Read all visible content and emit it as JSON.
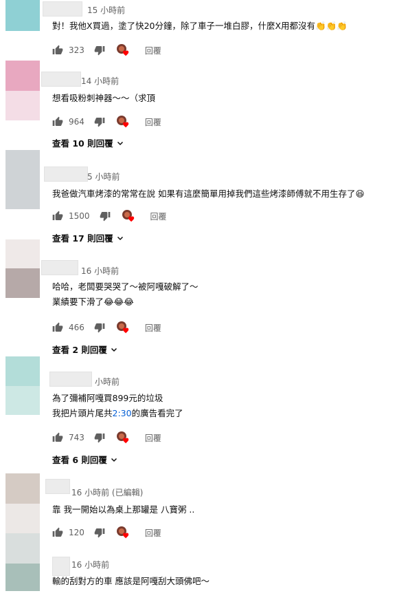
{
  "comments": [
    {
      "time": "15 小時前",
      "text": [
        "對！我他X買過，塗了快20分鐘，除了車子一堆白膠，什麼X用都沒有👏👏👏"
      ],
      "likes": "323",
      "reply": "回覆",
      "view_replies": ""
    },
    {
      "time": "14 小時前",
      "text": [
        "想看吸粉刺神器～～（求頂"
      ],
      "likes": "964",
      "reply": "回覆",
      "view_replies": "查看 10 則回覆"
    },
    {
      "time": "5 小時前",
      "text": [
        "我爸做汽車烤漆的常常在說  如果有這麼簡單用掉我們這些烤漆師傅就不用生存了😆"
      ],
      "likes": "1500",
      "reply": "回覆",
      "view_replies": "查看 17 則回覆"
    },
    {
      "time": "16 小時前",
      "text": [
        "哈哈，老闆要哭哭了～被阿嘎破解了～",
        "業績要下滑了😂😂😂"
      ],
      "likes": "466",
      "reply": "回覆",
      "view_replies": "查看 2 則回覆"
    },
    {
      "time": "小時前",
      "text": [
        "為了彌補阿嘎買899元的垃圾"
      ],
      "text_link": {
        "before": "我把片頭片尾共",
        "link": "2:30",
        "after": "的廣告看完了"
      },
      "likes": "743",
      "reply": "回覆",
      "view_replies": "查看 6 則回覆"
    },
    {
      "time": "16 小時前 (已編輯)",
      "text": [
        "靠 我一開始以為桌上那罐是 八寶粥 .."
      ],
      "likes": "120",
      "reply": "回覆",
      "view_replies": ""
    },
    {
      "time": "16 小時前",
      "text": [
        "輸的刮對方的車   應該是阿嘎刮大頭佛吧～"
      ],
      "likes": "",
      "reply": "",
      "view_replies": ""
    }
  ],
  "colors": {
    "avatar_1": "#8fd0d4",
    "avatar_2a": "#e8a8c0",
    "avatar_2b": "#f4dde6",
    "avatar_3": "#cfd3d6",
    "avatar_4a": "#efe9e8",
    "avatar_4b": "#b6a9a8",
    "avatar_5a": "#b3ddd9",
    "avatar_5b": "#cde8e4",
    "avatar_6a": "#d5cbc4",
    "avatar_6b": "#ece8e6",
    "avatar_7a": "#d9dedd",
    "avatar_7b": "#a8bfb9",
    "heart": "#ff0000",
    "link": "#065fd4"
  },
  "icons": [
    "thumb-up-icon",
    "thumb-down-icon",
    "creator-heart-icon",
    "chevron-down-icon"
  ]
}
